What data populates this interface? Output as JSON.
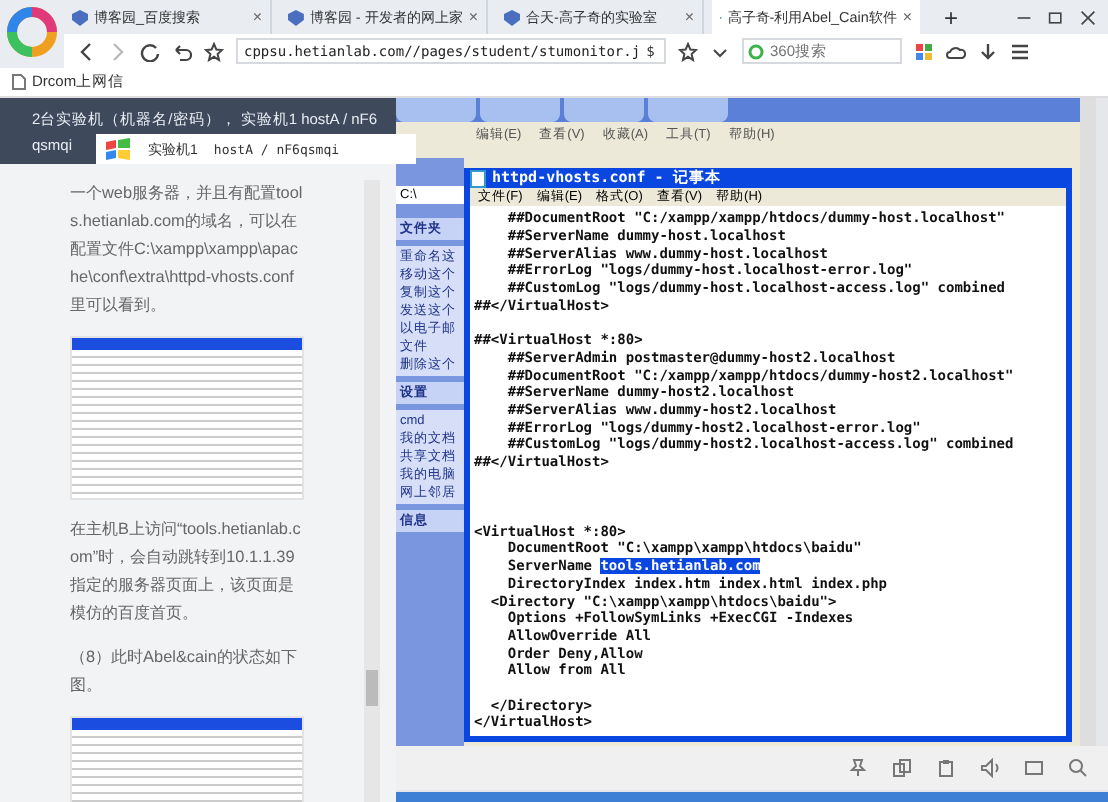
{
  "browser": {
    "tabs": [
      {
        "title": "博客园_百度搜索",
        "selected": false
      },
      {
        "title": "博客园 - 开发者的网上家",
        "selected": false
      },
      {
        "title": "合天-高子奇的实验室",
        "selected": false
      },
      {
        "title": "高子奇-利用Abel_Cain软件",
        "selected": true
      }
    ],
    "tab_close": "×",
    "new_tab": "+",
    "address": "cppsu.hetianlab.com//pages/student/stumonitor.j",
    "address_suffix": "$",
    "search": {
      "placeholder": "360搜索"
    },
    "bookmarks": [
      "Drcom上网信"
    ]
  },
  "lab_header": {
    "lines": [
      "2台实验机（机器名/密码）， 实验机1  hostA / nF6",
      "qsmqi"
    ],
    "machine_select": {
      "label": "实验机1",
      "value": "hostA / nF6qsmqi"
    }
  },
  "article": {
    "blocks": [
      {
        "kind": "paragraph",
        "text": "一个web服务器，并且有配置tools.hetianlab.com的域名，可以在配置文件C:\\xampp\\xampp\\apache\\conf\\extra\\httpd-vhosts.conf 里可以看到。"
      },
      {
        "kind": "image"
      },
      {
        "kind": "paragraph",
        "text": "在主机B上访问“tools.hetianlab.com”时，会自动跳转到10.1.1.39指定的服务器页面上，该页面是模仿的百度首页。"
      },
      {
        "kind": "paragraph",
        "text": "（8）此时Abel&cain的状态如下图。"
      },
      {
        "kind": "image"
      }
    ]
  },
  "explorer": {
    "menu": [
      "编辑(E)",
      "查看(V)",
      "收藏(A)",
      "工具(T)",
      "帮助(H)"
    ],
    "address": "C:\\",
    "task_header": "文件夹",
    "tasks": [
      "重命名这",
      "移动这个",
      "复制这个",
      "发送这个",
      "以电子邮",
      "文件",
      "删除这个"
    ],
    "places_header": "设置",
    "places": [
      "cmd",
      "我的文档",
      "共享文档",
      "我的电脑",
      "网上邻居"
    ],
    "details_header": "信息"
  },
  "notepad": {
    "title": "httpd-vhosts.conf - 记事本",
    "menu": [
      "文件(F)",
      "编辑(E)",
      "格式(O)",
      "查看(V)",
      "帮助(H)"
    ],
    "lines": [
      {
        "kind": "code",
        "text": "    ##DocumentRoot \"C:/xampp/xampp/htdocs/dummy-host.localhost\""
      },
      {
        "kind": "code",
        "text": "    ##ServerName dummy-host.localhost"
      },
      {
        "kind": "code",
        "text": "    ##ServerAlias www.dummy-host.localhost"
      },
      {
        "kind": "code",
        "text": "    ##ErrorLog \"logs/dummy-host.localhost-error.log\""
      },
      {
        "kind": "code",
        "text": "    ##CustomLog \"logs/dummy-host.localhost-access.log\" combined"
      },
      {
        "kind": "code",
        "text": "##</VirtualHost>"
      },
      {
        "kind": "blank"
      },
      {
        "kind": "code",
        "text": "##<VirtualHost *:80>"
      },
      {
        "kind": "code",
        "text": "    ##ServerAdmin postmaster@dummy-host2.localhost"
      },
      {
        "kind": "code",
        "text": "    ##DocumentRoot \"C:/xampp/xampp/htdocs/dummy-host2.localhost\""
      },
      {
        "kind": "code",
        "text": "    ##ServerName dummy-host2.localhost"
      },
      {
        "kind": "code",
        "text": "    ##ServerAlias www.dummy-host2.localhost"
      },
      {
        "kind": "code",
        "text": "    ##ErrorLog \"logs/dummy-host2.localhost-error.log\""
      },
      {
        "kind": "code",
        "text": "    ##CustomLog \"logs/dummy-host2.localhost-access.log\" combined"
      },
      {
        "kind": "code",
        "text": "##</VirtualHost>"
      },
      {
        "kind": "blank"
      },
      {
        "kind": "blank"
      },
      {
        "kind": "blank"
      },
      {
        "kind": "code",
        "text": "<VirtualHost *:80>"
      },
      {
        "kind": "code",
        "text": "    DocumentRoot \"C:\\xampp\\xampp\\htdocs\\baidu\""
      },
      {
        "kind": "code",
        "text": "    ServerName ",
        "selection": "tools.hetianlab.com"
      },
      {
        "kind": "code",
        "text": "    DirectoryIndex index.htm index.html index.php"
      },
      {
        "kind": "code",
        "text": "  <Directory \"C:\\xampp\\xampp\\htdocs\\baidu\">"
      },
      {
        "kind": "code",
        "text": "    Options +FollowSymLinks +ExecCGI -Indexes"
      },
      {
        "kind": "code",
        "text": "    AllowOverride All"
      },
      {
        "kind": "code",
        "text": "    Order Deny,Allow"
      },
      {
        "kind": "code",
        "text": "    Allow from All"
      },
      {
        "kind": "blank"
      },
      {
        "kind": "code",
        "text": "  </Directory>"
      },
      {
        "kind": "code",
        "text": "</VirtualHost>"
      }
    ]
  }
}
